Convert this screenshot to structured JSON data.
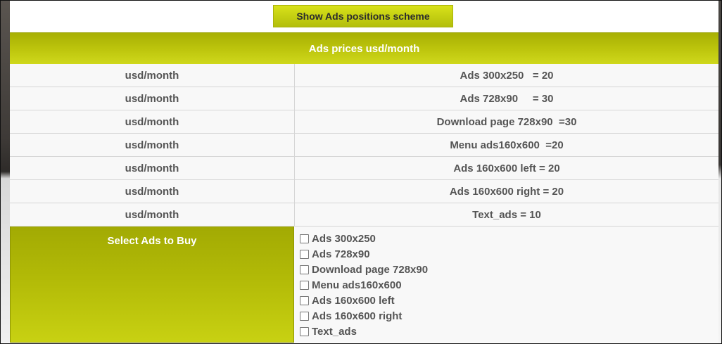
{
  "scheme_button": {
    "label": "Show Ads positions scheme"
  },
  "prices_table": {
    "header": "Ads prices usd/month",
    "rows": [
      {
        "unit": "usd/month",
        "item": "Ads 300x250   = 20"
      },
      {
        "unit": "usd/month",
        "item": "Ads 728x90     = 30"
      },
      {
        "unit": "usd/month",
        "item": "Download page 728x90  =30"
      },
      {
        "unit": "usd/month",
        "item": "Menu ads160x600  =20"
      },
      {
        "unit": "usd/month",
        "item": "Ads 160x600 left = 20"
      },
      {
        "unit": "usd/month",
        "item": "Ads 160x600 right = 20"
      },
      {
        "unit": "usd/month",
        "item": "Text_ads = 10"
      }
    ]
  },
  "select_section": {
    "label": "Select Ads to Buy",
    "options": [
      {
        "label": "Ads 300x250",
        "checked": false
      },
      {
        "label": "Ads 728x90",
        "checked": false
      },
      {
        "label": "Download page 728x90",
        "checked": false
      },
      {
        "label": "Menu ads160x600",
        "checked": false
      },
      {
        "label": "Ads 160x600 left",
        "checked": false
      },
      {
        "label": "Ads 160x600 right",
        "checked": false
      },
      {
        "label": "Text_ads",
        "checked": false
      }
    ]
  },
  "colors": {
    "accent": "#c5d012",
    "accent_dark": "#a8b004",
    "text": "#555555"
  }
}
